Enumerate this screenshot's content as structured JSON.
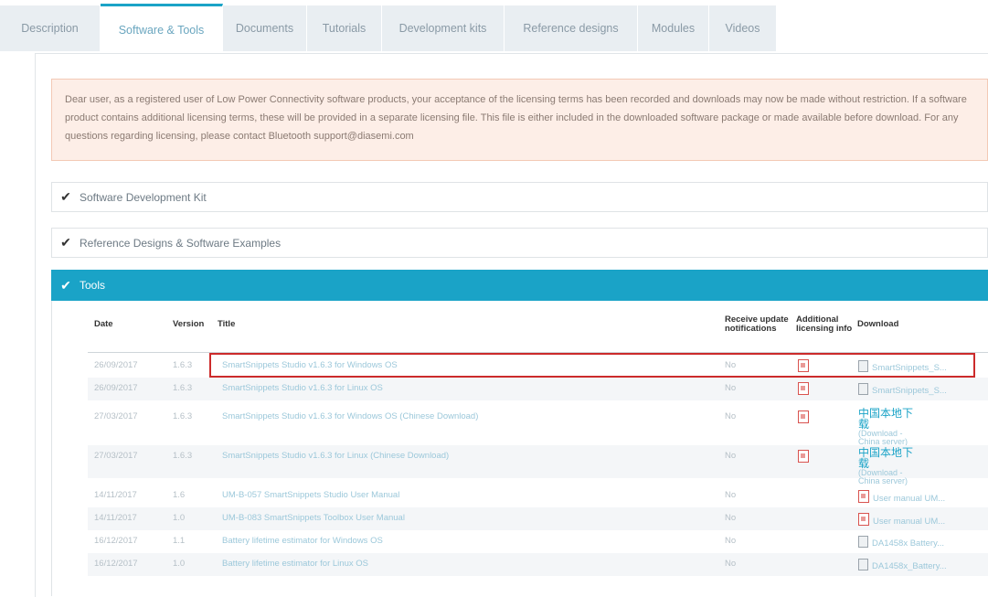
{
  "tabs": [
    "Description",
    "Software & Tools",
    "Documents",
    "Tutorials",
    "Development kits",
    "Reference designs",
    "Modules",
    "Videos"
  ],
  "active_tab": "Software & Tools",
  "notice": "Dear user, as a registered user of Low Power Connectivity software products, your acceptance of the licensing terms has been recorded and downloads may now be made without restriction. If a software product contains additional licensing terms, these will be provided in a separate licensing file. This file is either included in the downloaded software package or made available before download. For any questions regarding licensing, please contact Bluetooth support@diasemi.com",
  "sections": [
    {
      "label": "Software Development Kit",
      "open": false
    },
    {
      "label": "Reference Designs & Software Examples",
      "open": false
    },
    {
      "label": "Tools",
      "open": true
    }
  ],
  "table": {
    "headers": {
      "date": "Date",
      "version": "Version",
      "title": "Title",
      "receive": "Receive update notifications",
      "additional": "Additional licensing info",
      "download": "Download"
    },
    "rows": [
      {
        "date": "26/09/2017",
        "version": "1.6.3",
        "title": "SmartSnippets Studio v1.6.3 for Windows OS",
        "notify": "No",
        "lic_icon": "pdf-icon",
        "dl_icon": "zip-icon",
        "download": "SmartSnippets_S..."
      },
      {
        "date": "26/09/2017",
        "version": "1.6.3",
        "title": "SmartSnippets Studio v1.6.3 for Linux OS",
        "notify": "No",
        "lic_icon": "pdf-icon",
        "dl_icon": "zip-icon",
        "download": "SmartSnippets_S..."
      },
      {
        "date": "27/03/2017",
        "version": "1.6.3",
        "title": "SmartSnippets Studio v1.6.3 for Windows OS (Chinese Download)",
        "notify": "No",
        "lic_icon": "pdf-icon",
        "dl_icon": "",
        "download": "中国本地下载",
        "download_sub": "(Download - China server)"
      },
      {
        "date": "27/03/2017",
        "version": "1.6.3",
        "title": "SmartSnippets Studio v1.6.3 for Linux (Chinese Download)",
        "notify": "No",
        "lic_icon": "pdf-icon",
        "dl_icon": "",
        "download": "中国本地下载",
        "download_sub": "(Download - China server)"
      },
      {
        "date": "14/11/2017",
        "version": "1.6",
        "title": "UM-B-057 SmartSnippets Studio User Manual",
        "notify": "No",
        "lic_icon": "",
        "dl_icon": "pdf-icon",
        "download": "User manual UM..."
      },
      {
        "date": "14/11/2017",
        "version": "1.0",
        "title": "UM-B-083 SmartSnippets Toolbox User Manual",
        "notify": "No",
        "lic_icon": "",
        "dl_icon": "pdf-icon",
        "download": "User manual UM..."
      },
      {
        "date": "16/12/2017",
        "version": "1.1",
        "title": "Battery lifetime estimator for Windows OS",
        "notify": "No",
        "lic_icon": "",
        "dl_icon": "zip-icon",
        "download": "DA1458x Battery..."
      },
      {
        "date": "16/12/2017",
        "version": "1.0",
        "title": "Battery lifetime estimator for Linux OS",
        "notify": "No",
        "lic_icon": "",
        "dl_icon": "zip-icon",
        "download": "DA1458x_Battery..."
      }
    ]
  },
  "colors": {
    "accent": "#1aa3c7",
    "highlight": "#cc2b2b",
    "notice_bg": "#fdeee7"
  }
}
